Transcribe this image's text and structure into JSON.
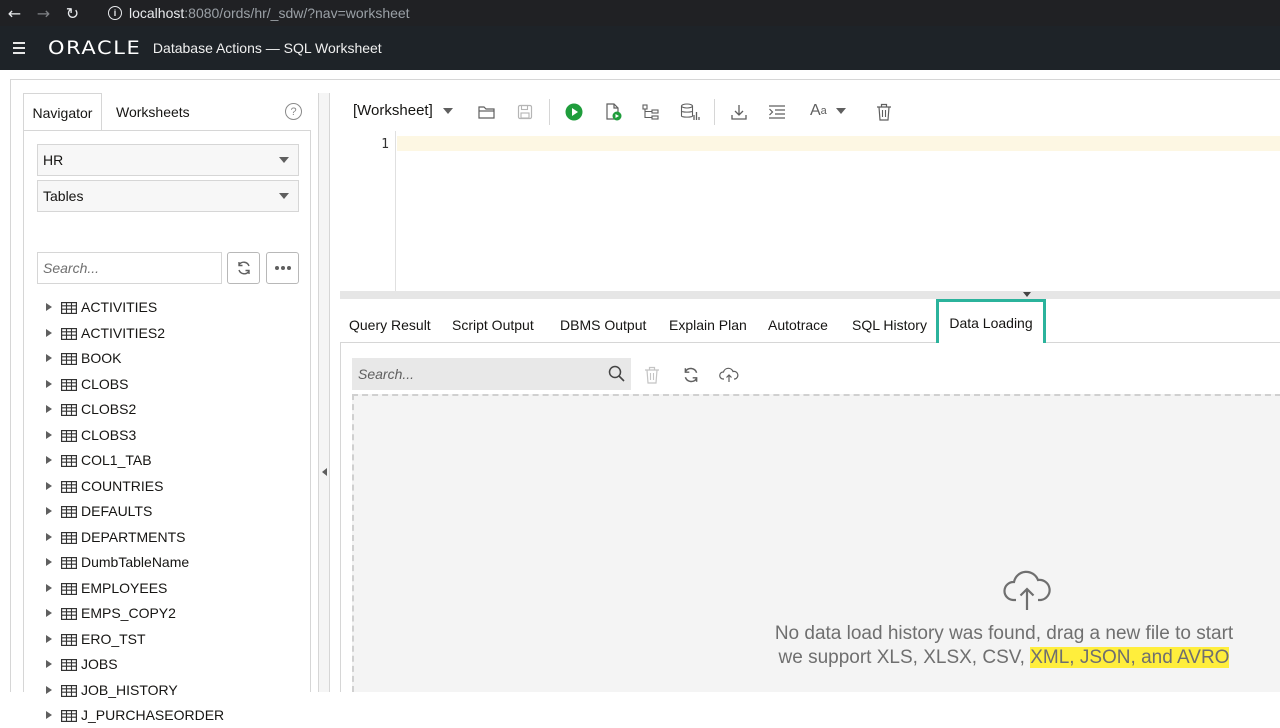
{
  "browser": {
    "url_host": "localhost",
    "url_rest": ":8080/ords/hr/_sdw/?nav=worksheet"
  },
  "header": {
    "logo": "ORACLE",
    "title": "Database Actions — SQL Worksheet"
  },
  "left_panel": {
    "tabs": [
      "Navigator",
      "Worksheets"
    ],
    "schema_select": "HR",
    "object_type_select": "Tables",
    "search_placeholder": "Search...",
    "tables": [
      "ACTIVITIES",
      "ACTIVITIES2",
      "BOOK",
      "CLOBS",
      "CLOBS2",
      "CLOBS3",
      "COL1_TAB",
      "COUNTRIES",
      "DEFAULTS",
      "DEPARTMENTS",
      "DumbTableName",
      "EMPLOYEES",
      "EMPS_COPY2",
      "ERO_TST",
      "JOBS",
      "JOB_HISTORY",
      "J_PURCHASEORDER"
    ]
  },
  "toolbar": {
    "worksheet_select": "[Worksheet]",
    "font_label": "A",
    "font_small": "a"
  },
  "editor": {
    "line_number": "1"
  },
  "result_tabs": {
    "tabs": [
      "Query Result",
      "Script Output",
      "DBMS Output",
      "Explain Plan",
      "Autotrace",
      "SQL History"
    ],
    "active": "Data Loading"
  },
  "data_loading": {
    "search_placeholder": "Search...",
    "message_line1": "No data load history was found, drag a new file to start",
    "message_line2_plain": "we support XLS, XLSX, CSV, ",
    "message_line2_highlight": "XML, JSON, and AVRO"
  },
  "colors": {
    "accent_tab_border": "#2bb39c",
    "run_button": "#1f9d3c",
    "highlight": "#ffee3c",
    "header_bg": "#1e2328"
  }
}
